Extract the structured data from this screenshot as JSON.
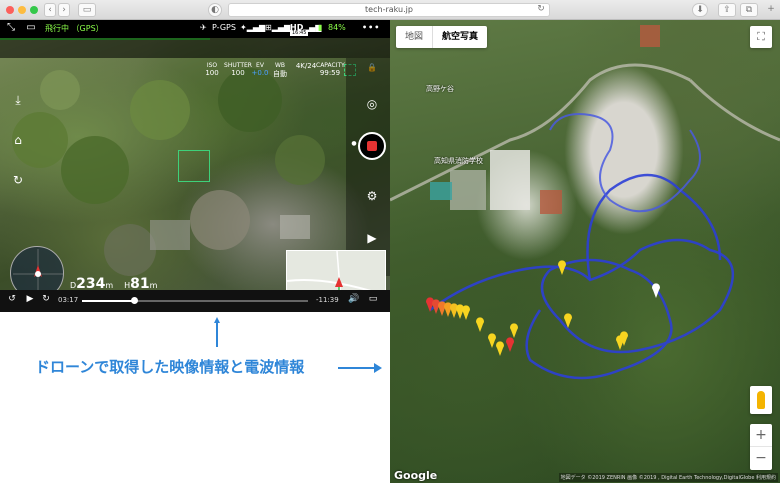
{
  "browser": {
    "url": "tech-raku.jp"
  },
  "drone_app": {
    "flight_status": "飛行中 （GPS）",
    "gps_mode": "P-GPS",
    "signal_label": "HD",
    "battery": "84%",
    "timer_badge": "16:45",
    "telemetry": [
      {
        "label": "ISO",
        "value": "100"
      },
      {
        "label": "SHUTTER",
        "value": "100"
      },
      {
        "label": "EV",
        "value": "+0.0"
      },
      {
        "label": "WB",
        "value": "自動"
      },
      {
        "label": "",
        "value": "4K/24"
      },
      {
        "label": "CAPACITY",
        "value": "99:59"
      }
    ],
    "distance_value": "234",
    "distance_unit": "m",
    "height_value": "81",
    "height_unit": "m",
    "height_prefix": "H",
    "distance_prefix": "D",
    "time_current": "03:17",
    "time_remaining": "-11:39",
    "progress_fraction": 0.23,
    "accent": "#8cff4a"
  },
  "caption": {
    "text": "ドローンで取得した映像情報と電波情報",
    "color": "#2f86d8"
  },
  "map": {
    "toggle_map": "地図",
    "toggle_satellite": "航空写真",
    "place_label_1": "高野ケ谷",
    "place_label_2": "高知県消防学校",
    "google": "Google",
    "attribution": "地図データ ©2019 ZENRIN 画像 ©2019 , Digital Earth Technology,DigitalGlobe   利用規約",
    "zoom_in": "+",
    "zoom_out": "−"
  }
}
